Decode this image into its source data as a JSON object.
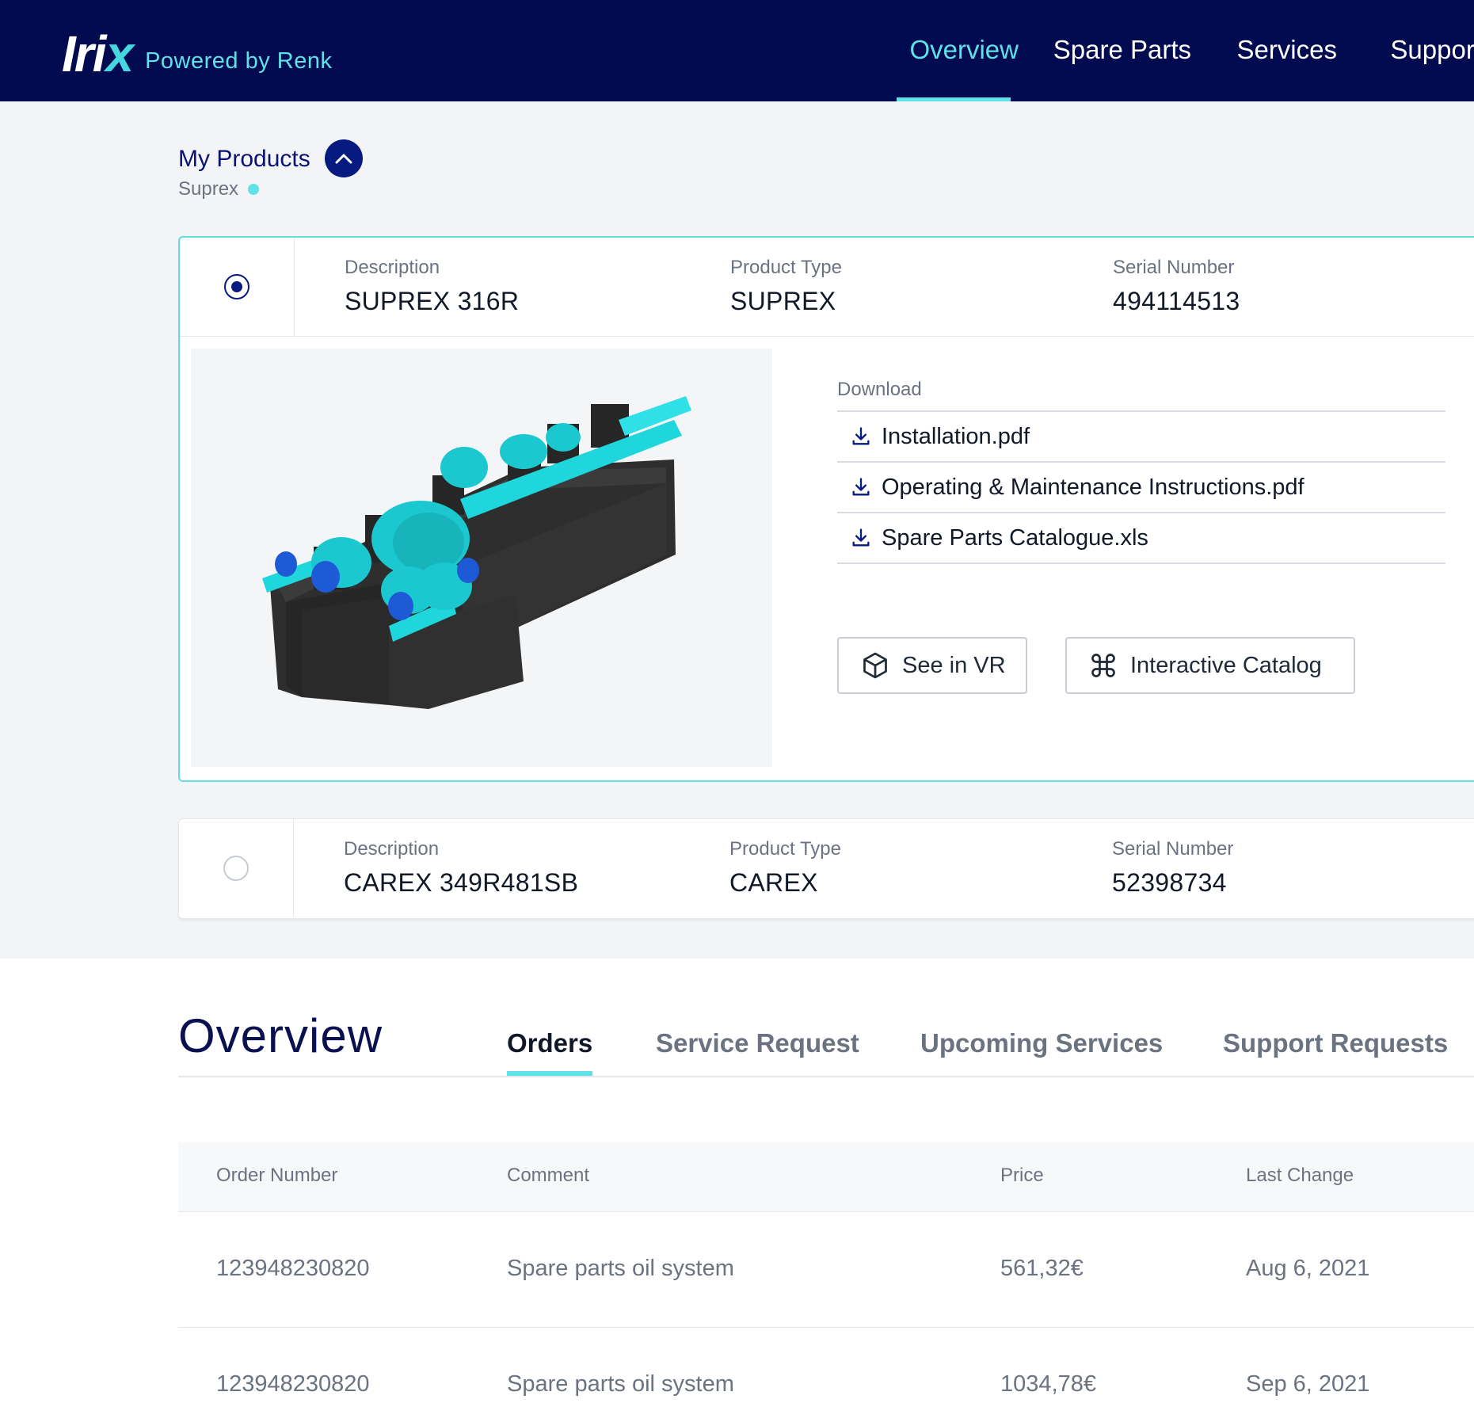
{
  "header": {
    "logo_text": "Iri",
    "logo_x": "x",
    "tagline": "Powered by Renk",
    "nav": [
      {
        "label": "Overview",
        "active": true
      },
      {
        "label": "Spare Parts",
        "active": false
      },
      {
        "label": "Services",
        "active": false
      },
      {
        "label": "Support",
        "active": false
      }
    ]
  },
  "products": {
    "title": "My Products",
    "subtitle": "Suprex",
    "items": [
      {
        "selected": true,
        "description_label": "Description",
        "description": "SUPREX 316R",
        "type_label": "Product Type",
        "type": "SUPREX",
        "serial_label": "Serial Number",
        "serial": "494114513",
        "downloads_label": "Download",
        "downloads": [
          "Installation.pdf",
          "Operating & Maintenance Instructions.pdf",
          "Spare Parts Catalogue.xls"
        ],
        "vr_button": "See in VR",
        "catalog_button": "Interactive Catalog"
      },
      {
        "selected": false,
        "description_label": "Description",
        "description": "CAREX 349R481SB",
        "type_label": "Product Type",
        "type": "CAREX",
        "serial_label": "Serial Number",
        "serial": "52398734"
      }
    ]
  },
  "overview": {
    "title": "Overview",
    "tabs": [
      {
        "label": "Orders",
        "active": true
      },
      {
        "label": "Service Request",
        "active": false
      },
      {
        "label": "Upcoming Services",
        "active": false
      },
      {
        "label": "Support Requests",
        "active": false
      }
    ],
    "table": {
      "columns": [
        "Order Number",
        "Comment",
        "Price",
        "Last Change"
      ],
      "rows": [
        [
          "123948230820",
          "Spare parts oil system",
          "561,32€",
          "Aug 6, 2021"
        ],
        [
          "123948230820",
          "Spare parts oil system",
          "1034,78€",
          "Sep 6, 2021"
        ]
      ]
    }
  },
  "colors": {
    "header_bg": "#020b4f",
    "accent": "#5fe1e8",
    "primary": "#071a80"
  }
}
